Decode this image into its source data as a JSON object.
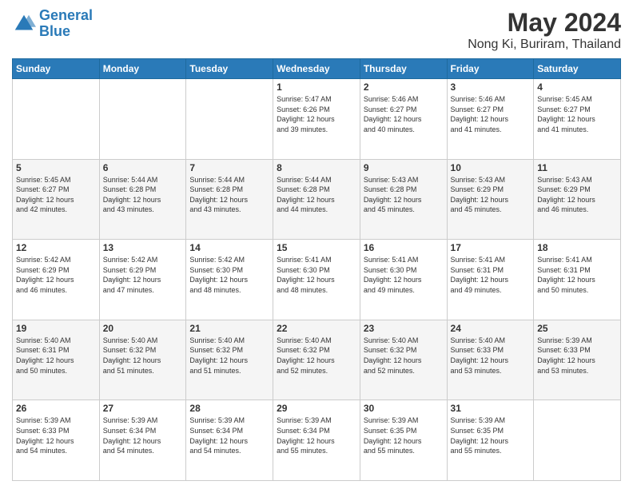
{
  "header": {
    "logo_line1": "General",
    "logo_line2": "Blue",
    "title": "May 2024",
    "subtitle": "Nong Ki, Buriram, Thailand"
  },
  "calendar": {
    "days_of_week": [
      "Sunday",
      "Monday",
      "Tuesday",
      "Wednesday",
      "Thursday",
      "Friday",
      "Saturday"
    ],
    "weeks": [
      [
        {
          "day": "",
          "info": ""
        },
        {
          "day": "",
          "info": ""
        },
        {
          "day": "",
          "info": ""
        },
        {
          "day": "1",
          "info": "Sunrise: 5:47 AM\nSunset: 6:26 PM\nDaylight: 12 hours\nand 39 minutes."
        },
        {
          "day": "2",
          "info": "Sunrise: 5:46 AM\nSunset: 6:27 PM\nDaylight: 12 hours\nand 40 minutes."
        },
        {
          "day": "3",
          "info": "Sunrise: 5:46 AM\nSunset: 6:27 PM\nDaylight: 12 hours\nand 41 minutes."
        },
        {
          "day": "4",
          "info": "Sunrise: 5:45 AM\nSunset: 6:27 PM\nDaylight: 12 hours\nand 41 minutes."
        }
      ],
      [
        {
          "day": "5",
          "info": "Sunrise: 5:45 AM\nSunset: 6:27 PM\nDaylight: 12 hours\nand 42 minutes."
        },
        {
          "day": "6",
          "info": "Sunrise: 5:44 AM\nSunset: 6:28 PM\nDaylight: 12 hours\nand 43 minutes."
        },
        {
          "day": "7",
          "info": "Sunrise: 5:44 AM\nSunset: 6:28 PM\nDaylight: 12 hours\nand 43 minutes."
        },
        {
          "day": "8",
          "info": "Sunrise: 5:44 AM\nSunset: 6:28 PM\nDaylight: 12 hours\nand 44 minutes."
        },
        {
          "day": "9",
          "info": "Sunrise: 5:43 AM\nSunset: 6:28 PM\nDaylight: 12 hours\nand 45 minutes."
        },
        {
          "day": "10",
          "info": "Sunrise: 5:43 AM\nSunset: 6:29 PM\nDaylight: 12 hours\nand 45 minutes."
        },
        {
          "day": "11",
          "info": "Sunrise: 5:43 AM\nSunset: 6:29 PM\nDaylight: 12 hours\nand 46 minutes."
        }
      ],
      [
        {
          "day": "12",
          "info": "Sunrise: 5:42 AM\nSunset: 6:29 PM\nDaylight: 12 hours\nand 46 minutes."
        },
        {
          "day": "13",
          "info": "Sunrise: 5:42 AM\nSunset: 6:29 PM\nDaylight: 12 hours\nand 47 minutes."
        },
        {
          "day": "14",
          "info": "Sunrise: 5:42 AM\nSunset: 6:30 PM\nDaylight: 12 hours\nand 48 minutes."
        },
        {
          "day": "15",
          "info": "Sunrise: 5:41 AM\nSunset: 6:30 PM\nDaylight: 12 hours\nand 48 minutes."
        },
        {
          "day": "16",
          "info": "Sunrise: 5:41 AM\nSunset: 6:30 PM\nDaylight: 12 hours\nand 49 minutes."
        },
        {
          "day": "17",
          "info": "Sunrise: 5:41 AM\nSunset: 6:31 PM\nDaylight: 12 hours\nand 49 minutes."
        },
        {
          "day": "18",
          "info": "Sunrise: 5:41 AM\nSunset: 6:31 PM\nDaylight: 12 hours\nand 50 minutes."
        }
      ],
      [
        {
          "day": "19",
          "info": "Sunrise: 5:40 AM\nSunset: 6:31 PM\nDaylight: 12 hours\nand 50 minutes."
        },
        {
          "day": "20",
          "info": "Sunrise: 5:40 AM\nSunset: 6:32 PM\nDaylight: 12 hours\nand 51 minutes."
        },
        {
          "day": "21",
          "info": "Sunrise: 5:40 AM\nSunset: 6:32 PM\nDaylight: 12 hours\nand 51 minutes."
        },
        {
          "day": "22",
          "info": "Sunrise: 5:40 AM\nSunset: 6:32 PM\nDaylight: 12 hours\nand 52 minutes."
        },
        {
          "day": "23",
          "info": "Sunrise: 5:40 AM\nSunset: 6:32 PM\nDaylight: 12 hours\nand 52 minutes."
        },
        {
          "day": "24",
          "info": "Sunrise: 5:40 AM\nSunset: 6:33 PM\nDaylight: 12 hours\nand 53 minutes."
        },
        {
          "day": "25",
          "info": "Sunrise: 5:39 AM\nSunset: 6:33 PM\nDaylight: 12 hours\nand 53 minutes."
        }
      ],
      [
        {
          "day": "26",
          "info": "Sunrise: 5:39 AM\nSunset: 6:33 PM\nDaylight: 12 hours\nand 54 minutes."
        },
        {
          "day": "27",
          "info": "Sunrise: 5:39 AM\nSunset: 6:34 PM\nDaylight: 12 hours\nand 54 minutes."
        },
        {
          "day": "28",
          "info": "Sunrise: 5:39 AM\nSunset: 6:34 PM\nDaylight: 12 hours\nand 54 minutes."
        },
        {
          "day": "29",
          "info": "Sunrise: 5:39 AM\nSunset: 6:34 PM\nDaylight: 12 hours\nand 55 minutes."
        },
        {
          "day": "30",
          "info": "Sunrise: 5:39 AM\nSunset: 6:35 PM\nDaylight: 12 hours\nand 55 minutes."
        },
        {
          "day": "31",
          "info": "Sunrise: 5:39 AM\nSunset: 6:35 PM\nDaylight: 12 hours\nand 55 minutes."
        },
        {
          "day": "",
          "info": ""
        }
      ]
    ]
  }
}
